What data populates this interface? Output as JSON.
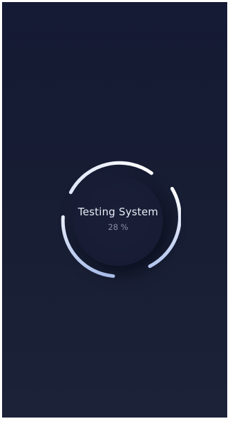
{
  "loader": {
    "title": "Testing System",
    "percent_text": "28 %",
    "progress": 0.28
  },
  "colors": {
    "background": "#171d33",
    "arc": "#f4f6fb",
    "arc_fade": "#9fb6e6",
    "title": "#e9ecf4",
    "percent": "#8a8fa3"
  }
}
